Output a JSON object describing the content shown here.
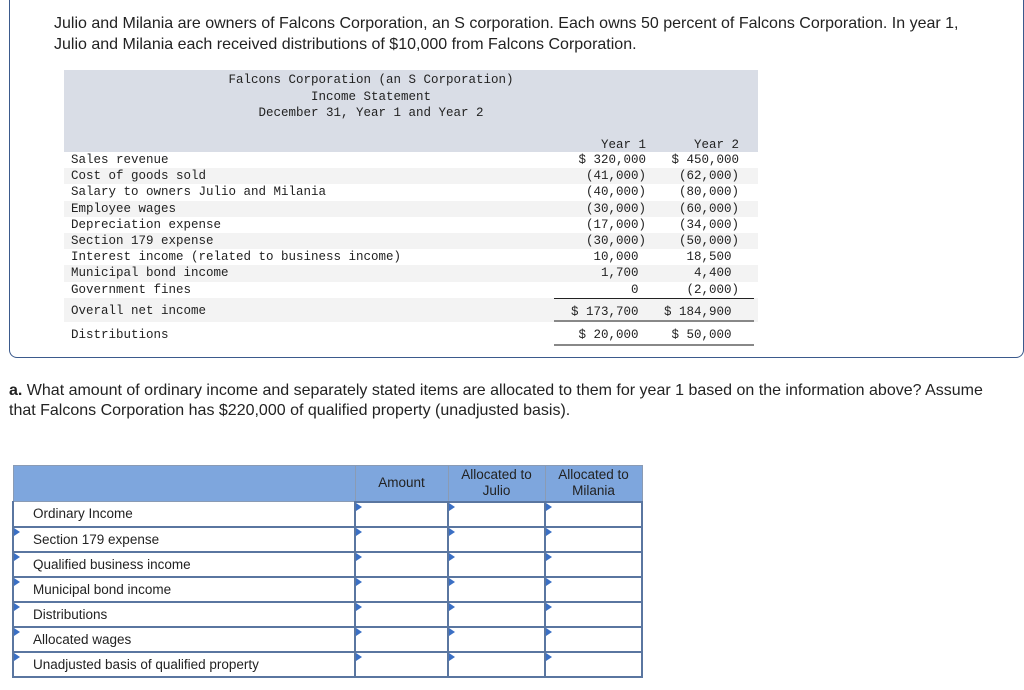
{
  "intro_text": "Julio and Milania are owners of Falcons Corporation, an S corporation. Each owns 50 percent of Falcons Corporation. In year 1, Julio and Milania each received distributions of $10,000 from Falcons Corporation.",
  "statement": {
    "title_line1": "Falcons Corporation (an S Corporation)",
    "title_line2": "Income Statement",
    "title_line3": "December 31, Year 1 and Year 2",
    "col1": "Year 1",
    "col2": "Year 2",
    "rows": [
      {
        "label": "Sales revenue",
        "y1": "$ 320,000",
        "y2": "$ 450,000"
      },
      {
        "label": "Cost of goods sold",
        "y1": "(41,000)",
        "y2": "(62,000)"
      },
      {
        "label": "Salary to owners Julio and Milania",
        "y1": "(40,000)",
        "y2": "(80,000)"
      },
      {
        "label": "Employee wages",
        "y1": "(30,000)",
        "y2": "(60,000)"
      },
      {
        "label": "Depreciation expense",
        "y1": "(17,000)",
        "y2": "(34,000)"
      },
      {
        "label": "Section 179 expense",
        "y1": "(30,000)",
        "y2": "(50,000)"
      },
      {
        "label": "Interest income (related to business income)",
        "y1": "10,000 ",
        "y2": "18,500 "
      },
      {
        "label": "Municipal bond income",
        "y1": "1,700 ",
        "y2": "4,400 "
      },
      {
        "label": "Government fines",
        "y1": "0 ",
        "y2": "(2,000)"
      }
    ],
    "total": {
      "label": "Overall net income",
      "y1": "$ 173,700 ",
      "y2": "$ 184,900 "
    },
    "distributions": {
      "label": "Distributions",
      "y1": "$ 20,000 ",
      "y2": "$ 50,000 "
    }
  },
  "question": {
    "prefix": "a.",
    "text": " What amount of ordinary income and separately stated items are allocated to them for year 1 based on the information above? Assume that Falcons Corporation has $220,000 of qualified property (unadjusted basis)."
  },
  "answer_table": {
    "headers": [
      "",
      "Amount",
      "Allocated to Julio",
      "Allocated to Milania"
    ],
    "rows": [
      {
        "label": "Ordinary Income",
        "amount": "",
        "julio": "",
        "milania": ""
      },
      {
        "label": "Section 179 expense",
        "amount": "",
        "julio": "",
        "milania": ""
      },
      {
        "label": "Qualified business income",
        "amount": "",
        "julio": "",
        "milania": ""
      },
      {
        "label": "Municipal bond income",
        "amount": "",
        "julio": "",
        "milania": ""
      },
      {
        "label": "Distributions",
        "amount": "",
        "julio": "",
        "milania": ""
      },
      {
        "label": "Allocated wages",
        "amount": "",
        "julio": "",
        "milania": ""
      },
      {
        "label": "Unadjusted basis of qualified property",
        "amount": "",
        "julio": "",
        "milania": ""
      }
    ]
  }
}
